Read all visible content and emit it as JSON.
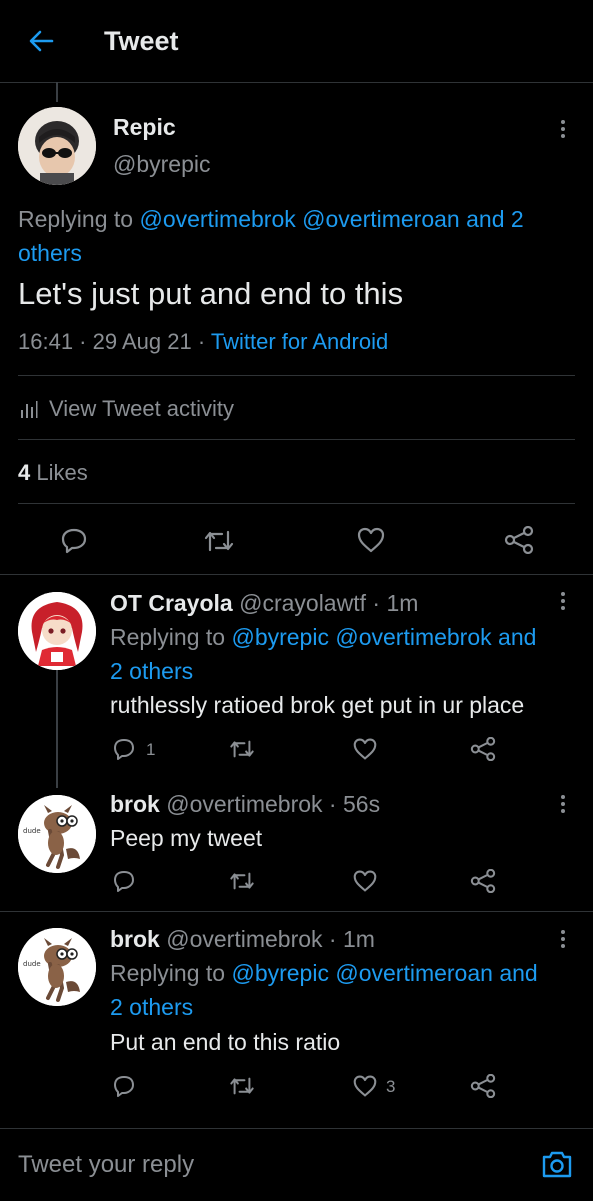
{
  "header": {
    "title": "Tweet"
  },
  "main_tweet": {
    "name": "Repic",
    "handle": "@byrepic",
    "replying_prefix": "Replying to ",
    "replying_users": "@overtimebrok @overtimeroan",
    "replying_and": " and 2",
    "replying_others": "others",
    "text": "Let's just put and end to this",
    "time": "16:41",
    "date": "29 Aug 21",
    "source": "Twitter for Android",
    "activity_label": "View Tweet activity",
    "likes_count": "4",
    "likes_label": "Likes"
  },
  "replies": [
    {
      "name": "OT Crayola",
      "handle": "@crayolawtf",
      "time": "1m",
      "replying_prefix": "Replying to ",
      "replying_users": "@byrepic @overtimebrok",
      "replying_and": " and",
      "replying_others": "2 others",
      "text": "ruthlessly ratioed brok get put in ur place",
      "reply_count": "1",
      "retweet_count": "",
      "like_count": ""
    },
    {
      "name": "brok",
      "handle": "@overtimebrok",
      "time": "56s",
      "text": "Peep my tweet",
      "avatar_caption": "dude",
      "reply_count": "",
      "retweet_count": "",
      "like_count": ""
    },
    {
      "name": "brok",
      "handle": "@overtimebrok",
      "time": "1m",
      "replying_prefix": "Replying to ",
      "replying_users": "@byrepic @overtimeroan",
      "replying_and": " and",
      "replying_others": "2 others",
      "text": "Put an end to this ratio",
      "avatar_caption": "dude",
      "reply_count": "",
      "retweet_count": "",
      "like_count": "3"
    }
  ],
  "reply_bar": {
    "placeholder": "Tweet your reply"
  },
  "colors": {
    "background": "#000000",
    "accent": "#1d9bf0",
    "secondary_text": "#8b8f94",
    "divider": "#2f3336"
  },
  "icons": [
    "back-arrow-icon",
    "more-vertical-icon",
    "bar-chart-icon",
    "reply-icon",
    "retweet-icon",
    "heart-icon",
    "share-icon",
    "camera-icon"
  ]
}
